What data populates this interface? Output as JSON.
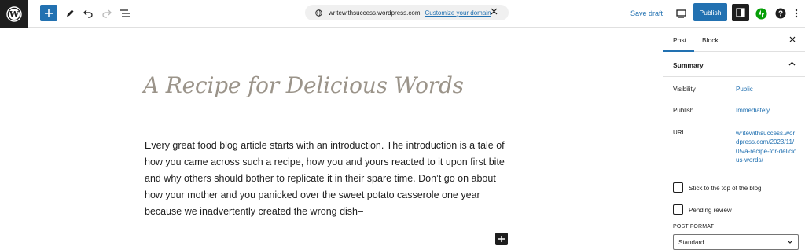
{
  "topbar": {
    "icons": {
      "logo": "wordpress-logo",
      "add": "plus-icon",
      "tools": "pencil-icon",
      "undo": "undo-icon",
      "redo": "redo-icon",
      "outline": "list-view-icon",
      "site_icon": "globe-icon",
      "close": "close-icon",
      "view": "desktop-icon",
      "settings": "sidebar-toggle-icon",
      "jetpack": "jetpack-icon",
      "help": "help-icon",
      "more": "more-vertical-icon"
    },
    "url": {
      "domain": "writewithsuccess.wordpress.com",
      "customize_label": "Customize your domain"
    },
    "save_draft_label": "Save draft",
    "publish_label": "Publish"
  },
  "editor": {
    "title": "A Recipe for Delicious Words",
    "body": "Every great food blog article starts with an introduction. The introduction is a tale of how you came across such a recipe, how you and yours reacted to it upon first bite and why others should bother to replicate it in their spare time. Don’t go on about how your mother and you panicked over the sweet potato casserole one year because we inadvertently created the wrong dish–"
  },
  "sidebar": {
    "tabs": [
      {
        "label": "Post",
        "active": true
      },
      {
        "label": "Block",
        "active": false
      }
    ],
    "summary": {
      "title": "Summary",
      "visibility_label": "Visibility",
      "visibility_value": "Public",
      "publish_label": "Publish",
      "publish_value": "Immediately",
      "url_label": "URL",
      "url_value": "writewithsuccess.wordpress.com/2023/11/05/a-recipe-for-delicious-words/",
      "sticky_label": "Stick to the top of the blog",
      "pending_label": "Pending review",
      "post_format_label": "POST FORMAT",
      "post_format_value": "Standard"
    }
  },
  "colors": {
    "accent": "#2271b1",
    "jetpack": "#069e08",
    "dark": "#1e1e1e",
    "title": "#9b948a"
  }
}
